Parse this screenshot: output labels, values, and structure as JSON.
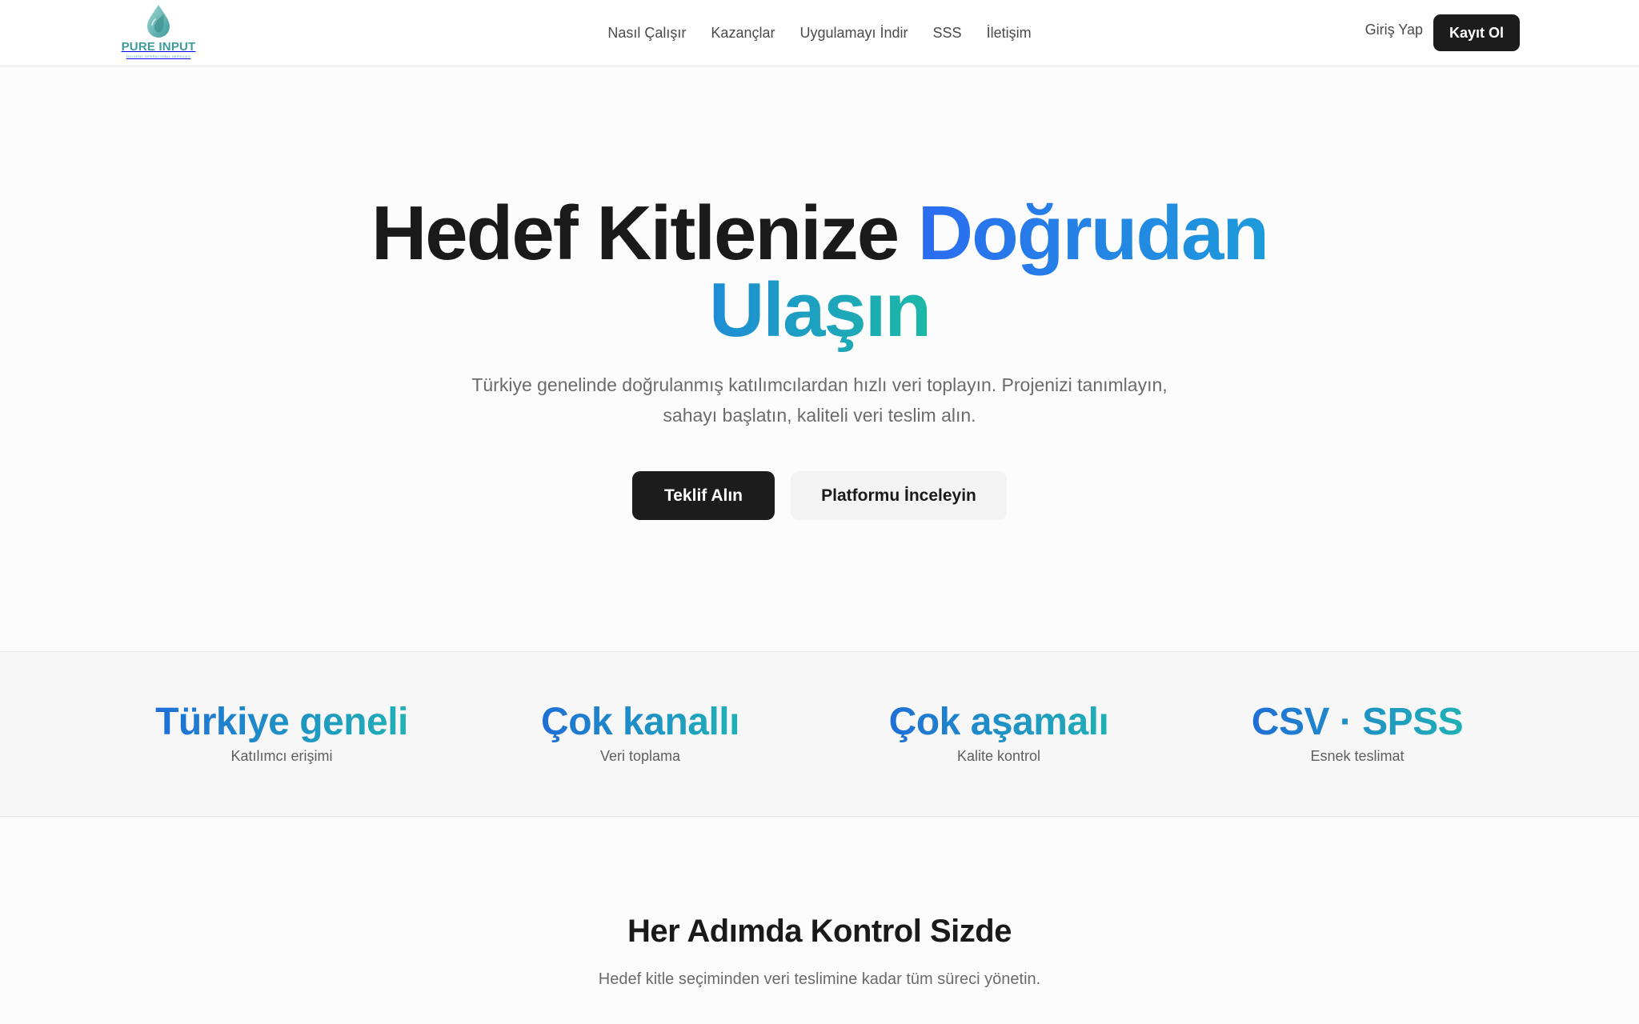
{
  "header": {
    "logo": {
      "name": "PURE INPUT",
      "tagline": "DILIGENT OPERATIONAL SERVICES",
      "icon": "droplet-icon"
    },
    "nav": [
      {
        "label": "Nasıl Çalışır"
      },
      {
        "label": "Kazançlar"
      },
      {
        "label": "Uygulamayı İndir"
      },
      {
        "label": "SSS"
      },
      {
        "label": "İletişim"
      }
    ],
    "login_label": "Giriş Yap",
    "signup_label": "Kayıt Ol"
  },
  "hero": {
    "title_part1": "Hedef Kitlenize ",
    "title_part2": "Doğrudan",
    "title_part3": "Ulaşın",
    "subtitle": "Türkiye genelinde doğrulanmış katılımcılardan hızlı veri toplayın. Projenizi tanımlayın, sahayı başlatın, kaliteli veri teslim alın.",
    "primary_cta": "Teklif Alın",
    "secondary_cta": "Platformu İnceleyin"
  },
  "stats": [
    {
      "value": "Türkiye geneli",
      "label": "Katılımcı erişimi"
    },
    {
      "value": "Çok kanallı",
      "label": "Veri toplama"
    },
    {
      "value": "Çok aşamalı",
      "label": "Kalite kontrol"
    },
    {
      "value": "CSV · SPSS",
      "label": "Esnek teslimat"
    }
  ],
  "section": {
    "title": "Her Adımda Kontrol Sizde",
    "subtitle": "Hedef kitle seçiminden veri teslimine kadar tüm süreci yönetin."
  },
  "colors": {
    "accent_blue": "#2b6cf0",
    "accent_teal": "#1cb9a6",
    "brand_teal": "#3d9c9b",
    "dark_button": "#1c1c1c"
  }
}
